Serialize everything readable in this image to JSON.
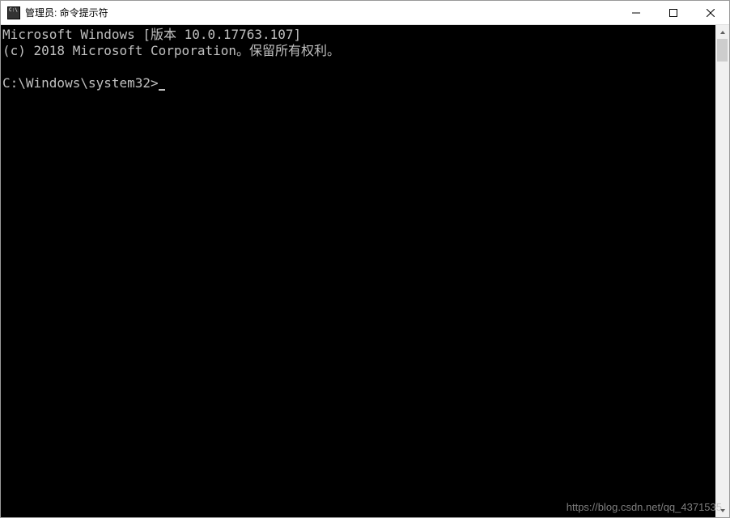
{
  "titlebar": {
    "title": "管理员: 命令提示符"
  },
  "console": {
    "line1": "Microsoft Windows [版本 10.0.17763.107]",
    "line2": "(c) 2018 Microsoft Corporation。保留所有权利。",
    "prompt": "C:\\Windows\\system32>"
  },
  "watermark": "https://blog.csdn.net/qq_4371535"
}
